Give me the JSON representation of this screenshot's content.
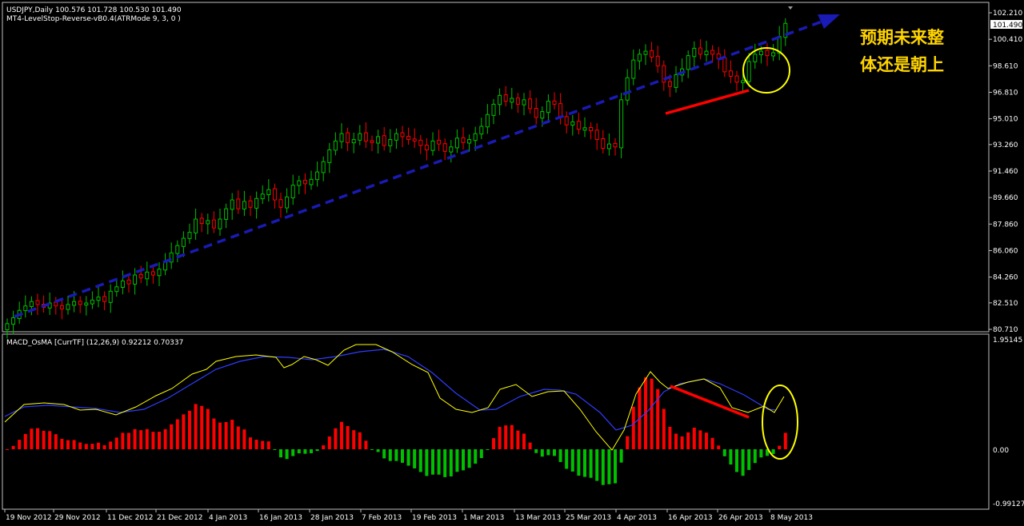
{
  "header": {
    "symbol_line": "USDJPY,Daily  100.576 101.728 100.530 101.490",
    "indicator_line": "MT4-LevelStop-Reverse-vB0.4(ATRMode 9, 3, 0 )",
    "osc_line": "MACD_OsMA [CurrTF] (12,26,9) 0.92212 0.70337"
  },
  "annotation": {
    "line1": "预期未来整",
    "line2": "体还是朝上"
  },
  "colors": {
    "background": "#000000",
    "frame": "#c0c0c0",
    "bull_candle": "#00c000",
    "bear_candle": "#ff0000",
    "trend_arrow": "#1a1ab4",
    "divergence_line": "#ff0000",
    "circle": "#ffff00",
    "macd_fast": "#ffff00",
    "macd_signal": "#2f3cff",
    "hist_pos": "#ff0000",
    "hist_neg": "#00c000",
    "annotation_text": "#ffd400"
  },
  "chart_data": [
    {
      "type": "candlestick",
      "symbol": "USDJPY",
      "timeframe": "Daily",
      "ylim": [
        80.71,
        102.21
      ],
      "y_ticks": [
        "102.210",
        "100.410",
        "98.610",
        "96.810",
        "95.010",
        "93.260",
        "91.460",
        "89.660",
        "87.860",
        "86.060",
        "84.260",
        "82.510",
        "80.710"
      ],
      "current_price": "101.490",
      "x_ticks": [
        "19 Nov 2012",
        "29 Nov 2012",
        "11 Dec 2012",
        "21 Dec 2012",
        "4 Jan 2013",
        "16 Jan 2013",
        "28 Jan 2013",
        "7 Feb 2013",
        "19 Feb 2013",
        "1 Mar 2013",
        "13 Mar 2013",
        "25 Mar 2013",
        "4 Apr 2013",
        "16 Apr 2013",
        "26 Apr 2013",
        "8 May 2013"
      ],
      "closes": [
        81.1,
        81.5,
        82.0,
        82.3,
        82.6,
        82.4,
        82.2,
        82.5,
        82.3,
        82.1,
        82.4,
        82.6,
        82.4,
        82.5,
        82.7,
        82.9,
        82.6,
        83.3,
        83.6,
        84.0,
        83.8,
        84.4,
        84.2,
        84.6,
        84.4,
        84.8,
        85.3,
        85.9,
        86.4,
        86.9,
        87.3,
        88.2,
        87.9,
        88.1,
        87.6,
        88.2,
        88.9,
        89.5,
        88.9,
        89.4,
        89.0,
        89.6,
        89.9,
        90.2,
        89.5,
        89.0,
        89.7,
        90.5,
        90.8,
        90.6,
        90.9,
        91.4,
        92.1,
        92.9,
        93.5,
        94.0,
        93.4,
        93.6,
        94.0,
        93.5,
        93.4,
        93.8,
        93.2,
        93.6,
        94.0,
        93.8,
        93.6,
        93.5,
        93.2,
        92.9,
        93.5,
        93.3,
        92.8,
        93.1,
        93.7,
        93.4,
        93.6,
        94.0,
        94.5,
        95.3,
        96.0,
        96.6,
        96.2,
        96.4,
        96.0,
        96.3,
        95.7,
        95.1,
        95.5,
        96.2,
        96.0,
        95.1,
        94.6,
        94.8,
        94.3,
        94.4,
        94.2,
        93.6,
        93.0,
        93.3,
        93.1,
        96.3,
        97.8,
        99.0,
        99.4,
        99.6,
        99.2,
        98.6,
        97.5,
        97.2,
        98.0,
        98.4,
        99.3,
        99.8,
        99.4,
        99.6,
        99.4,
        99.1,
        98.2,
        97.9,
        97.5,
        97.6,
        98.9,
        99.4,
        99.6,
        99.3,
        99.5,
        100.6,
        101.49
      ]
    },
    {
      "type": "macd_osma",
      "name": "MACD_OsMA [CurrTF] (12,26,9)",
      "ylim": [
        -0.99127,
        1.95145
      ],
      "y_ticks": [
        "1.95145",
        "0.00",
        "-0.99127"
      ]
    }
  ]
}
